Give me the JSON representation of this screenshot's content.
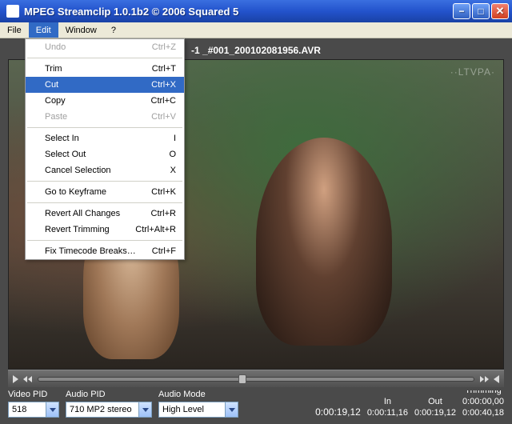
{
  "window": {
    "title": "MPEG Streamclip 1.0.1b2    ©  2006  Squared 5"
  },
  "menubar": {
    "file": "File",
    "edit": "Edit",
    "window": "Window",
    "help": "?"
  },
  "file_path": "-1 _#001_200102081956.AVR",
  "watermark": "··LTVPA·",
  "edit_menu": {
    "undo": {
      "label": "Undo",
      "shortcut": "Ctrl+Z"
    },
    "trim": {
      "label": "Trim",
      "shortcut": "Ctrl+T"
    },
    "cut": {
      "label": "Cut",
      "shortcut": "Ctrl+X"
    },
    "copy": {
      "label": "Copy",
      "shortcut": "Ctrl+C"
    },
    "paste": {
      "label": "Paste",
      "shortcut": "Ctrl+V"
    },
    "select_in": {
      "label": "Select In",
      "shortcut": "I"
    },
    "select_out": {
      "label": "Select Out",
      "shortcut": "O"
    },
    "cancel_sel": {
      "label": "Cancel Selection",
      "shortcut": "X"
    },
    "goto_kf": {
      "label": "Go to Keyframe",
      "shortcut": "Ctrl+K"
    },
    "revert_all": {
      "label": "Revert All Changes",
      "shortcut": "Ctrl+R"
    },
    "revert_trim": {
      "label": "Revert Trimming",
      "shortcut": "Ctrl+Alt+R"
    },
    "fix_tc": {
      "label": "Fix Timecode Breaks…",
      "shortcut": "Ctrl+F"
    }
  },
  "controls": {
    "video_pid": {
      "label": "Video PID",
      "value": "518"
    },
    "audio_pid": {
      "label": "Audio PID",
      "value": "710 MP2 stereo"
    },
    "audio_mode": {
      "label": "Audio Mode",
      "value": "High Level"
    }
  },
  "times": {
    "current": "0:00:19,12",
    "in_label": "In",
    "in_value": "0:00:11,16",
    "out_label": "Out",
    "out_value": "0:00:19,12",
    "trim_label": "Trimming",
    "trim_top": "0:00:00,00",
    "trim_bottom": "0:00:40,18"
  },
  "seek_percent": 46
}
